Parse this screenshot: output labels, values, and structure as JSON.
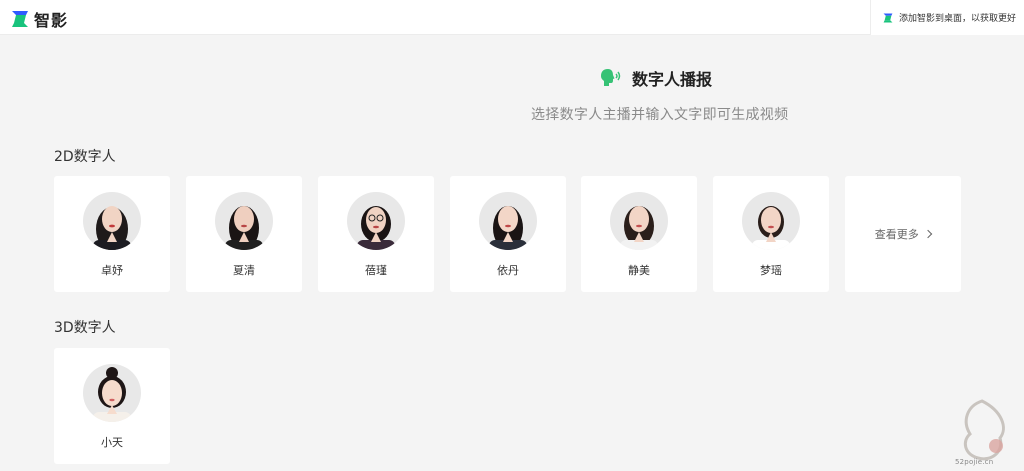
{
  "app": {
    "name": "智影"
  },
  "topbar": {
    "promo_text": "添加智影到桌面，以获取更好"
  },
  "header": {
    "title": "数字人播报",
    "subtitle": "选择数字人主播并输入文字即可生成视频"
  },
  "sections": {
    "two_d": {
      "title": "2D数字人",
      "avatars": [
        {
          "name": "卓妤"
        },
        {
          "name": "夏清"
        },
        {
          "name": "蓓瑾"
        },
        {
          "name": "依丹"
        },
        {
          "name": "静美"
        },
        {
          "name": "梦瑶"
        }
      ],
      "more_label": "查看更多"
    },
    "three_d": {
      "title": "3D数字人",
      "avatars": [
        {
          "name": "小天"
        }
      ]
    }
  },
  "watermark": {
    "url": "52pojie.cn"
  },
  "colors": {
    "brand_green": "#19c37d",
    "brand_blue": "#2f5bff",
    "speak_icon": "#36c275"
  }
}
